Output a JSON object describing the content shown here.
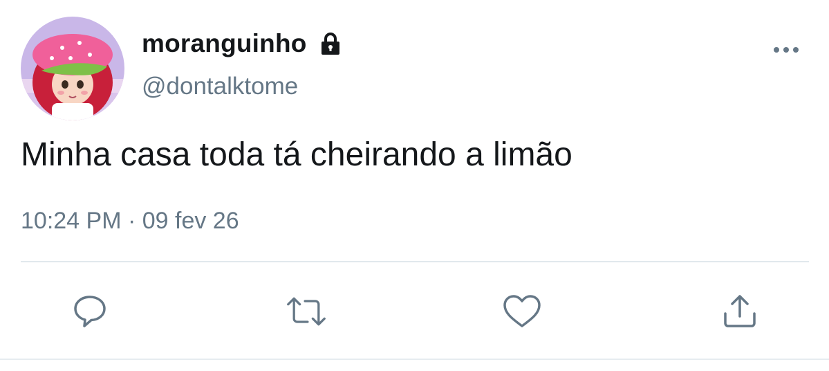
{
  "user": {
    "display_name": "moranguinho",
    "username": "@dontalktome",
    "avatar_icon": "avatar",
    "protected_icon": "lock-icon"
  },
  "tweet": {
    "text": "Minha casa toda tá cheirando a limão",
    "timestamp": "10:24 PM · 09 fev 26"
  },
  "actions": [
    {
      "name": "reply",
      "icon": "reply-icon"
    },
    {
      "name": "retweet",
      "icon": "retweet-icon"
    },
    {
      "name": "like",
      "icon": "heart-icon"
    },
    {
      "name": "share",
      "icon": "share-icon"
    }
  ],
  "colors": {
    "text_primary": "#14171a",
    "text_secondary": "#657786",
    "icon": "#657786",
    "divider": "#e1e8ed"
  }
}
